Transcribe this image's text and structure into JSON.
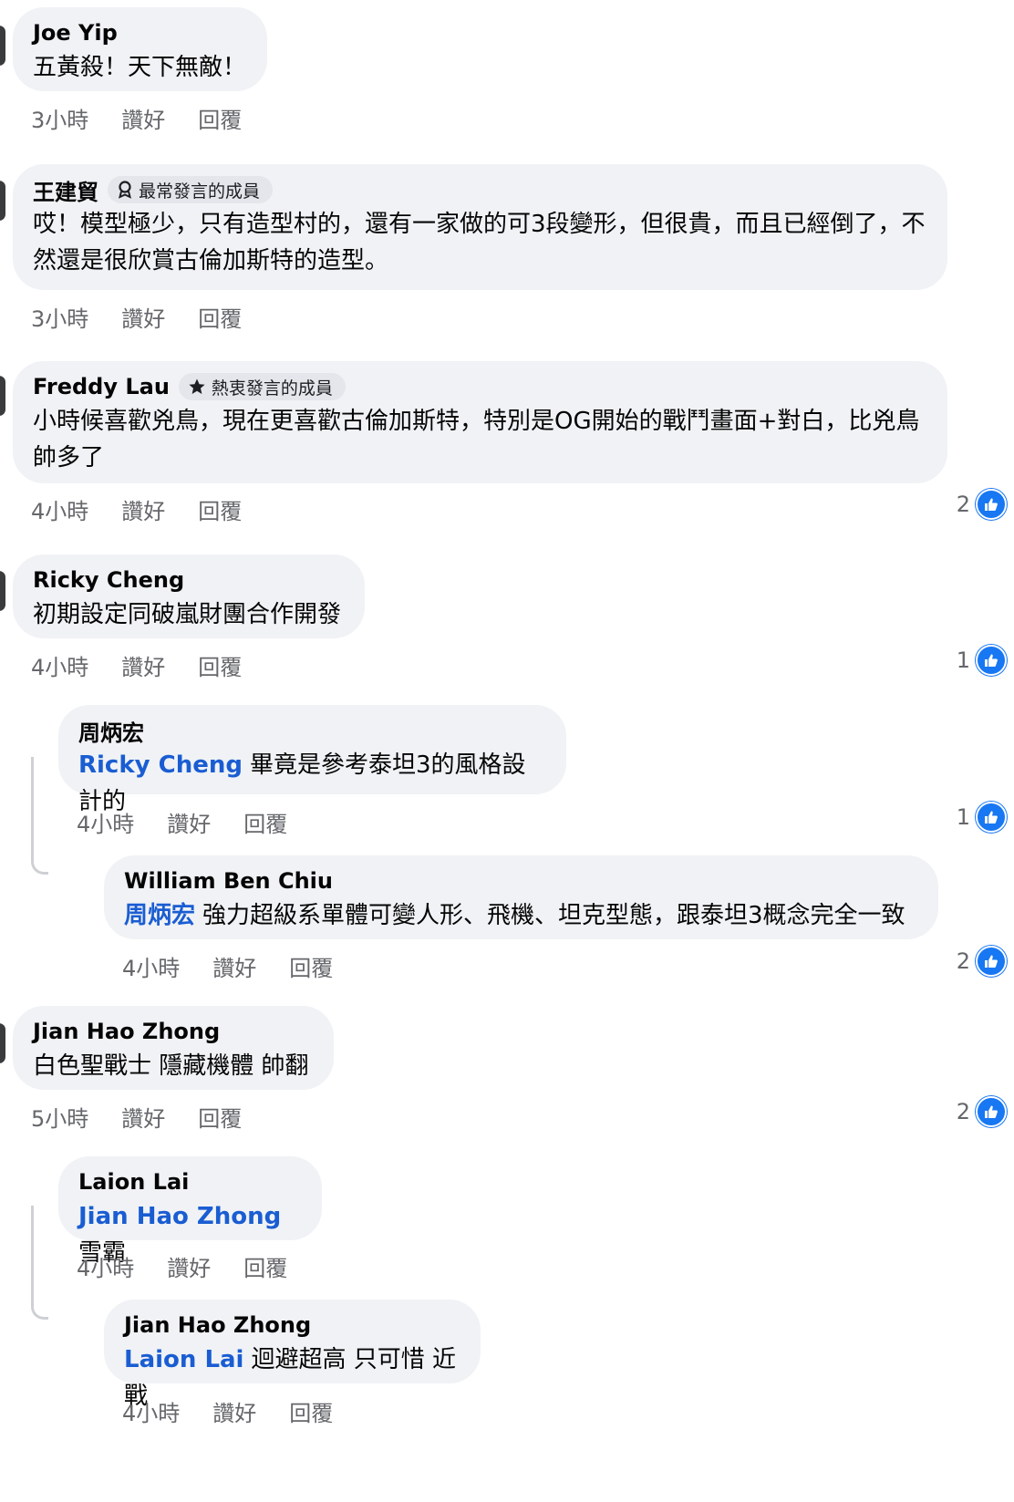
{
  "comments": [
    {
      "author": "Joe Yip",
      "text": "五黃殺！天下無敵！",
      "time": "3小時",
      "like_label": "讚好",
      "reply_label": "回覆"
    },
    {
      "author": "王建貿",
      "badge": "最常發言的成員",
      "badge_icon": "medal-icon",
      "text": "哎！模型極少，只有造型村的，還有一家做的可3段變形，但很貴，而且已經倒了，不然還是很欣賞古倫加斯特的造型。",
      "time": "3小時",
      "like_label": "讚好",
      "reply_label": "回覆"
    },
    {
      "author": "Freddy Lau",
      "badge": "熱衷發言的成員",
      "badge_icon": "star-icon",
      "text": "小時候喜歡兇鳥，現在更喜歡古倫加斯特，特別是OG開始的戰鬥畫面+對白，比兇鳥帥多了",
      "time": "4小時",
      "like_label": "讚好",
      "reply_label": "回覆",
      "reaction_count": "2"
    },
    {
      "author": "Ricky Cheng",
      "text": "初期設定同破嵐財團合作開發",
      "time": "4小時",
      "like_label": "讚好",
      "reply_label": "回覆",
      "reaction_count": "1"
    },
    {
      "author": "周炳宏",
      "mention": "Ricky Cheng",
      "text": "畢竟是參考泰坦3的風格設計的",
      "time": "4小時",
      "like_label": "讚好",
      "reply_label": "回覆",
      "reaction_count": "1"
    },
    {
      "author": "William Ben Chiu",
      "mention": "周炳宏",
      "text": "強力超級系單體可變人形、飛機、坦克型態，跟泰坦3概念完全一致",
      "time": "4小時",
      "like_label": "讚好",
      "reply_label": "回覆",
      "reaction_count": "2"
    },
    {
      "author": "Jian Hao Zhong",
      "text": "白色聖戰士 隱藏機體 帥翻",
      "time": "5小時",
      "like_label": "讚好",
      "reply_label": "回覆",
      "reaction_count": "2"
    },
    {
      "author": "Laion Lai",
      "mention": "Jian Hao Zhong",
      "text": "雪霸",
      "time": "4小時",
      "like_label": "讚好",
      "reply_label": "回覆"
    },
    {
      "author": "Jian Hao Zhong",
      "mention": "Laion Lai",
      "text": "迴避超高 只可惜 近戰",
      "time": "4小時",
      "like_label": "讚好",
      "reply_label": "回覆"
    }
  ],
  "colors": {
    "bubble": "#f0f2f5",
    "mention": "#1a5dd2",
    "like_blue": "#1877f2",
    "meta_gray": "#65676b"
  }
}
